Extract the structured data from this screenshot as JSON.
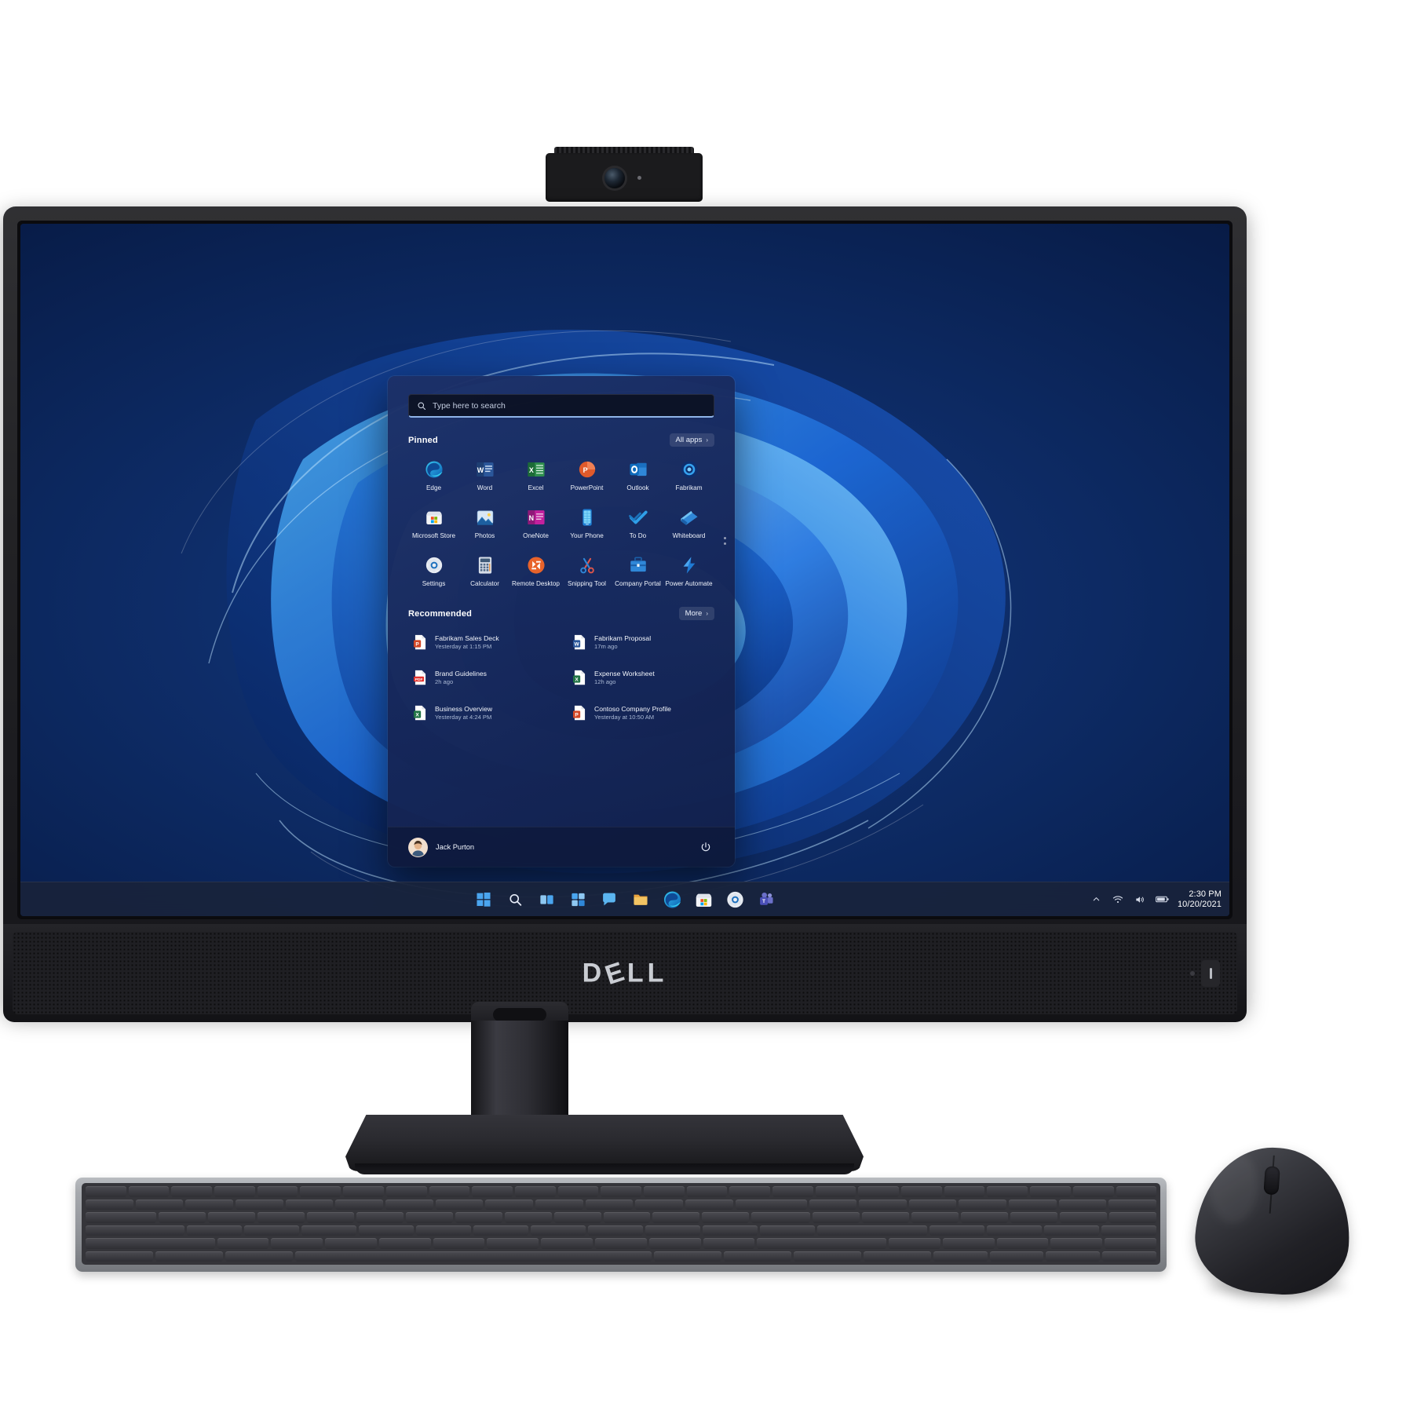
{
  "product": {
    "brand_logo_text": "DØLL",
    "device_name": "dell-all-in-one-desktop",
    "webcam_label": "pop-up-webcam",
    "power_button_label": "power-button"
  },
  "desktop": {
    "wallpaper_name": "windows-11-bloom-wallpaper"
  },
  "taskbar": {
    "items": [
      {
        "name": "start-button",
        "label": "Start",
        "icon": "windows-logo-icon"
      },
      {
        "name": "search-button",
        "label": "Search",
        "icon": "search-icon"
      },
      {
        "name": "task-view-button",
        "label": "Task View",
        "icon": "task-view-icon"
      },
      {
        "name": "widgets-button",
        "label": "Widgets",
        "icon": "widgets-icon"
      },
      {
        "name": "chat-button",
        "label": "Chat",
        "icon": "chat-icon"
      },
      {
        "name": "file-explorer-button",
        "label": "File Explorer",
        "icon": "folder-icon"
      },
      {
        "name": "edge-button",
        "label": "Microsoft Edge",
        "icon": "edge-icon"
      },
      {
        "name": "store-button",
        "label": "Microsoft Store",
        "icon": "store-icon"
      },
      {
        "name": "settings-button",
        "label": "Settings",
        "icon": "gear-icon"
      },
      {
        "name": "teams-button",
        "label": "Microsoft Teams",
        "icon": "teams-icon"
      }
    ],
    "tray": [
      {
        "name": "show-hidden-icons",
        "icon": "chevron-up-icon"
      },
      {
        "name": "network-status",
        "icon": "wifi-icon"
      },
      {
        "name": "volume-status",
        "icon": "speaker-icon"
      },
      {
        "name": "battery-status",
        "icon": "battery-icon"
      }
    ],
    "clock": {
      "time": "2:30 PM",
      "date": "10/20/2021"
    }
  },
  "start_menu": {
    "search": {
      "placeholder": "Type here to search"
    },
    "pinned": {
      "title": "Pinned",
      "all_apps_label": "All apps",
      "chevron": "›",
      "apps": [
        {
          "label": "Edge",
          "icon": "edge-icon"
        },
        {
          "label": "Word",
          "icon": "word-icon"
        },
        {
          "label": "Excel",
          "icon": "excel-icon"
        },
        {
          "label": "PowerPoint",
          "icon": "powerpoint-icon"
        },
        {
          "label": "Outlook",
          "icon": "outlook-icon"
        },
        {
          "label": "Fabrikam",
          "icon": "fabrikam-icon"
        },
        {
          "label": "Microsoft Store",
          "icon": "store-icon"
        },
        {
          "label": "Photos",
          "icon": "photos-icon"
        },
        {
          "label": "OneNote",
          "icon": "onenote-icon"
        },
        {
          "label": "Your Phone",
          "icon": "your-phone-icon"
        },
        {
          "label": "To Do",
          "icon": "todo-icon"
        },
        {
          "label": "Whiteboard",
          "icon": "whiteboard-icon"
        },
        {
          "label": "Settings",
          "icon": "gear-icon"
        },
        {
          "label": "Calculator",
          "icon": "calculator-icon"
        },
        {
          "label": "Remote Desktop",
          "icon": "remote-desktop-icon"
        },
        {
          "label": "Snipping Tool",
          "icon": "snipping-tool-icon"
        },
        {
          "label": "Company Portal",
          "icon": "company-portal-icon"
        },
        {
          "label": "Power Automate",
          "icon": "power-automate-icon"
        }
      ]
    },
    "recommended": {
      "title": "Recommended",
      "more_label": "More",
      "chevron": "›",
      "items": [
        {
          "name": "Fabrikam Sales Deck",
          "meta": "Yesterday at 1:15 PM",
          "icon": "powerpoint-file-icon"
        },
        {
          "name": "Fabrikam Proposal",
          "meta": "17m ago",
          "icon": "word-file-icon"
        },
        {
          "name": "Brand Guidelines",
          "meta": "2h ago",
          "icon": "pdf-file-icon"
        },
        {
          "name": "Expense Worksheet",
          "meta": "12h ago",
          "icon": "excel-file-icon"
        },
        {
          "name": "Business Overview",
          "meta": "Yesterday at 4:24 PM",
          "icon": "excel-file-icon"
        },
        {
          "name": "Contoso Company Profile",
          "meta": "Yesterday at 10:50 AM",
          "icon": "powerpoint-file-icon"
        }
      ]
    },
    "footer": {
      "user_name": "Jack Purton",
      "power_label": "Power"
    }
  },
  "colors": {
    "accent": "#0078d4",
    "start_bg": "#16275a",
    "taskbar_bg": "#1a2339",
    "word": "#2b579a",
    "excel": "#217346",
    "powerpoint": "#d24726",
    "outlook": "#0f6cbd",
    "onenote": "#b4009e",
    "pdf": "#e3342f"
  }
}
